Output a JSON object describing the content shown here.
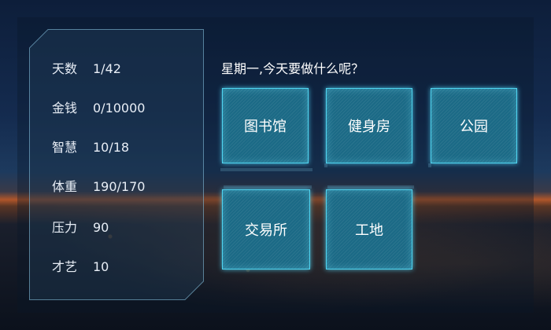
{
  "stats": [
    {
      "label": "天数",
      "value": "1/42"
    },
    {
      "label": "金钱",
      "value": "0/10000"
    },
    {
      "label": "智慧",
      "value": "10/18"
    },
    {
      "label": "体重",
      "value": "190/170"
    },
    {
      "label": "压力",
      "value": "90"
    },
    {
      "label": "才艺",
      "value": "10"
    }
  ],
  "prompt": "星期一,今天要做什么呢？",
  "locations": {
    "library": "图书馆",
    "gym": "健身房",
    "park": "公园",
    "exchange": "交易所",
    "construction_site": "工地"
  },
  "colors": {
    "button_fill": "#1b6a86",
    "button_glow": "#4fd4f0",
    "text": "#ffffff"
  }
}
